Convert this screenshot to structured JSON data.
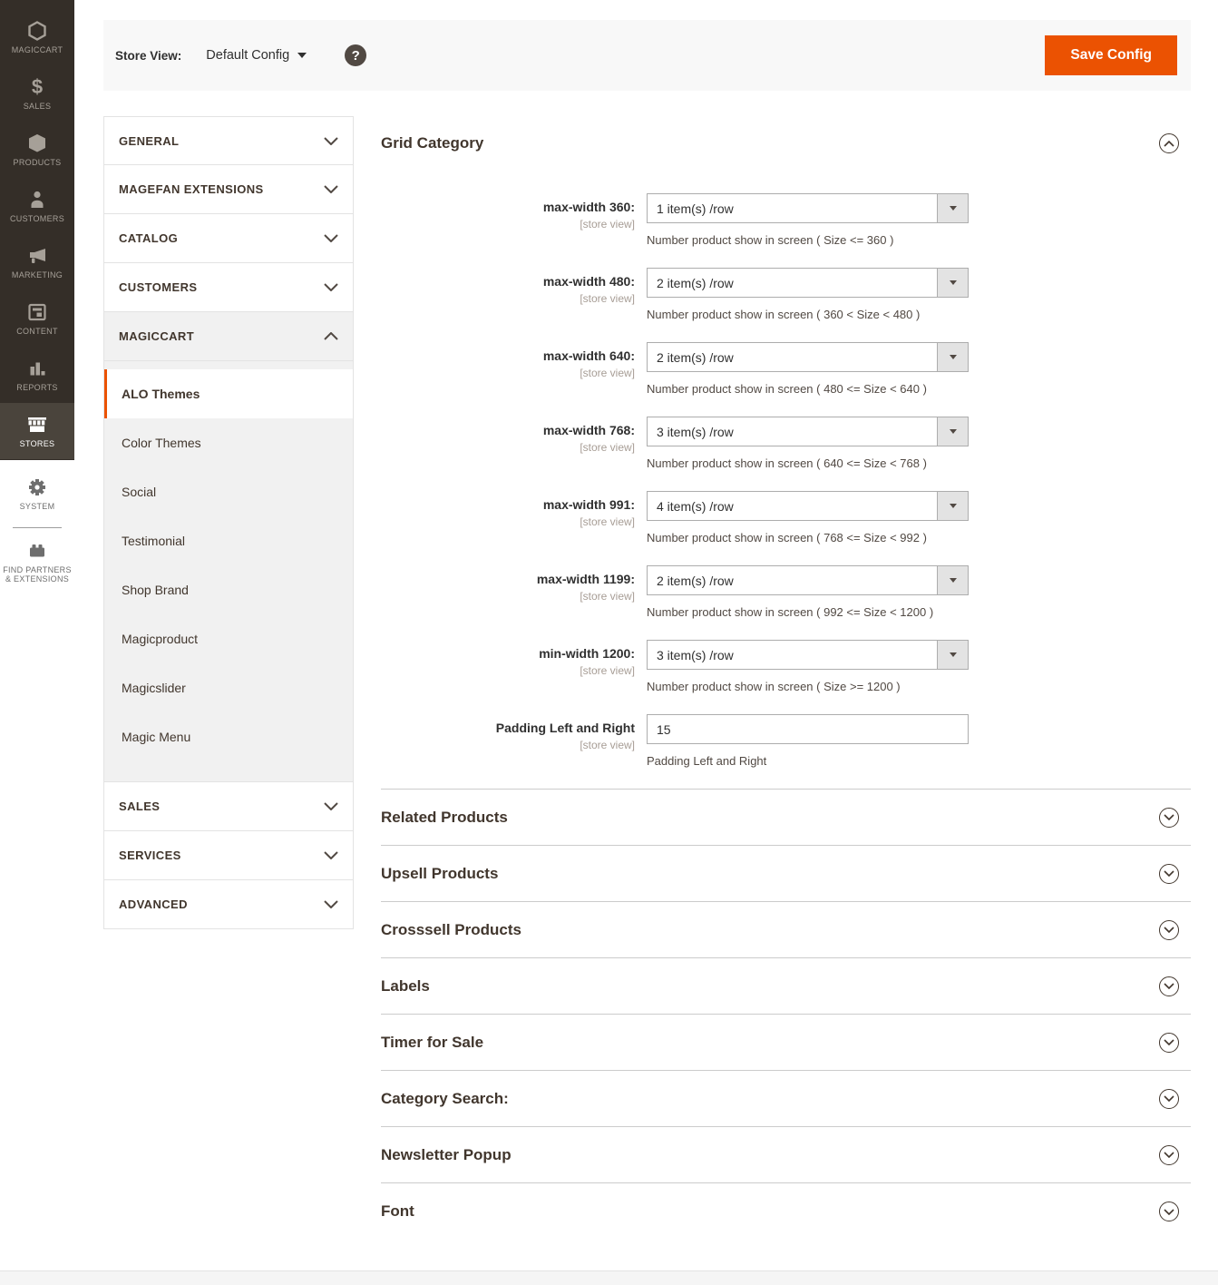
{
  "colors": {
    "accent_orange": "#eb5202",
    "menu_background": "#342e28",
    "menu_active_background": "#4a443c",
    "toolbar_gray": "#f8f8f8",
    "submenu_gray": "#f1f1f1",
    "border_gray": "#e3e3e3",
    "heading_dark": "#41362d"
  },
  "icon_glyphs": {
    "sales": "$"
  },
  "admin_sidebar": {
    "items": [
      {
        "label": "MAGICCART",
        "icon": "magiccart-hexagon-icon"
      },
      {
        "label": "SALES",
        "icon": "dollar-icon"
      },
      {
        "label": "PRODUCTS",
        "icon": "box-icon"
      },
      {
        "label": "CUSTOMERS",
        "icon": "person-icon"
      },
      {
        "label": "MARKETING",
        "icon": "megaphone-icon"
      },
      {
        "label": "CONTENT",
        "icon": "layout-icon"
      },
      {
        "label": "REPORTS",
        "icon": "bar-chart-icon"
      },
      {
        "label": "STORES",
        "icon": "storefront-icon",
        "active": true
      },
      {
        "label": "SYSTEM",
        "icon": "gear-icon"
      },
      {
        "label": "FIND PARTNERS & EXTENSIONS",
        "icon": "brick-icon"
      }
    ]
  },
  "toolbar": {
    "store_view_label": "Store View:",
    "store_view_value": "Default Config",
    "help_icon": "?",
    "save_button_label": "Save Config"
  },
  "config_nav": {
    "sections_top": [
      {
        "label": "GENERAL"
      },
      {
        "label": "MAGEFAN EXTENSIONS"
      },
      {
        "label": "CATALOG"
      },
      {
        "label": "CUSTOMERS"
      },
      {
        "label": "MAGICCART",
        "expanded": true
      }
    ],
    "magiccart_children": [
      {
        "label": "ALO Themes",
        "active": true
      },
      {
        "label": "Color Themes"
      },
      {
        "label": "Social"
      },
      {
        "label": "Testimonial"
      },
      {
        "label": "Shop Brand"
      },
      {
        "label": "Magicproduct"
      },
      {
        "label": "Magicslider"
      },
      {
        "label": "Magic Menu"
      }
    ],
    "sections_bottom": [
      {
        "label": "SALES"
      },
      {
        "label": "SERVICES"
      },
      {
        "label": "ADVANCED"
      }
    ]
  },
  "main": {
    "grid_category": {
      "title": "Grid Category",
      "fields": [
        {
          "label": "max-width 360:",
          "scope": "[store view]",
          "value": "1 item(s) /row",
          "note": "Number product show in screen ( Size <= 360 )"
        },
        {
          "label": "max-width 480:",
          "scope": "[store view]",
          "value": "2 item(s) /row",
          "note": "Number product show in screen ( 360 < Size < 480 )"
        },
        {
          "label": "max-width 640:",
          "scope": "[store view]",
          "value": "2 item(s) /row",
          "note": "Number product show in screen ( 480 <= Size < 640 )"
        },
        {
          "label": "max-width 768:",
          "scope": "[store view]",
          "value": "3 item(s) /row",
          "note": "Number product show in screen ( 640 <= Size < 768 )"
        },
        {
          "label": "max-width 991:",
          "scope": "[store view]",
          "value": "4 item(s) /row",
          "note": "Number product show in screen ( 768 <= Size < 992 )"
        },
        {
          "label": "max-width 1199:",
          "scope": "[store view]",
          "value": "2 item(s) /row",
          "note": "Number product show in screen ( 992 <= Size < 1200 )"
        },
        {
          "label": "min-width 1200:",
          "scope": "[store view]",
          "value": "3 item(s) /row",
          "note": "Number product show in screen ( Size >= 1200 )"
        },
        {
          "label": "Padding Left and Right",
          "scope": "[store view]",
          "value": "15",
          "note": "Padding Left and Right"
        }
      ]
    },
    "collapsed_sections": [
      {
        "title": "Related Products"
      },
      {
        "title": "Upsell Products"
      },
      {
        "title": "Crosssell Products"
      },
      {
        "title": "Labels"
      },
      {
        "title": "Timer for Sale"
      },
      {
        "title": "Category Search:"
      },
      {
        "title": "Newsletter Popup"
      },
      {
        "title": "Font"
      }
    ]
  }
}
